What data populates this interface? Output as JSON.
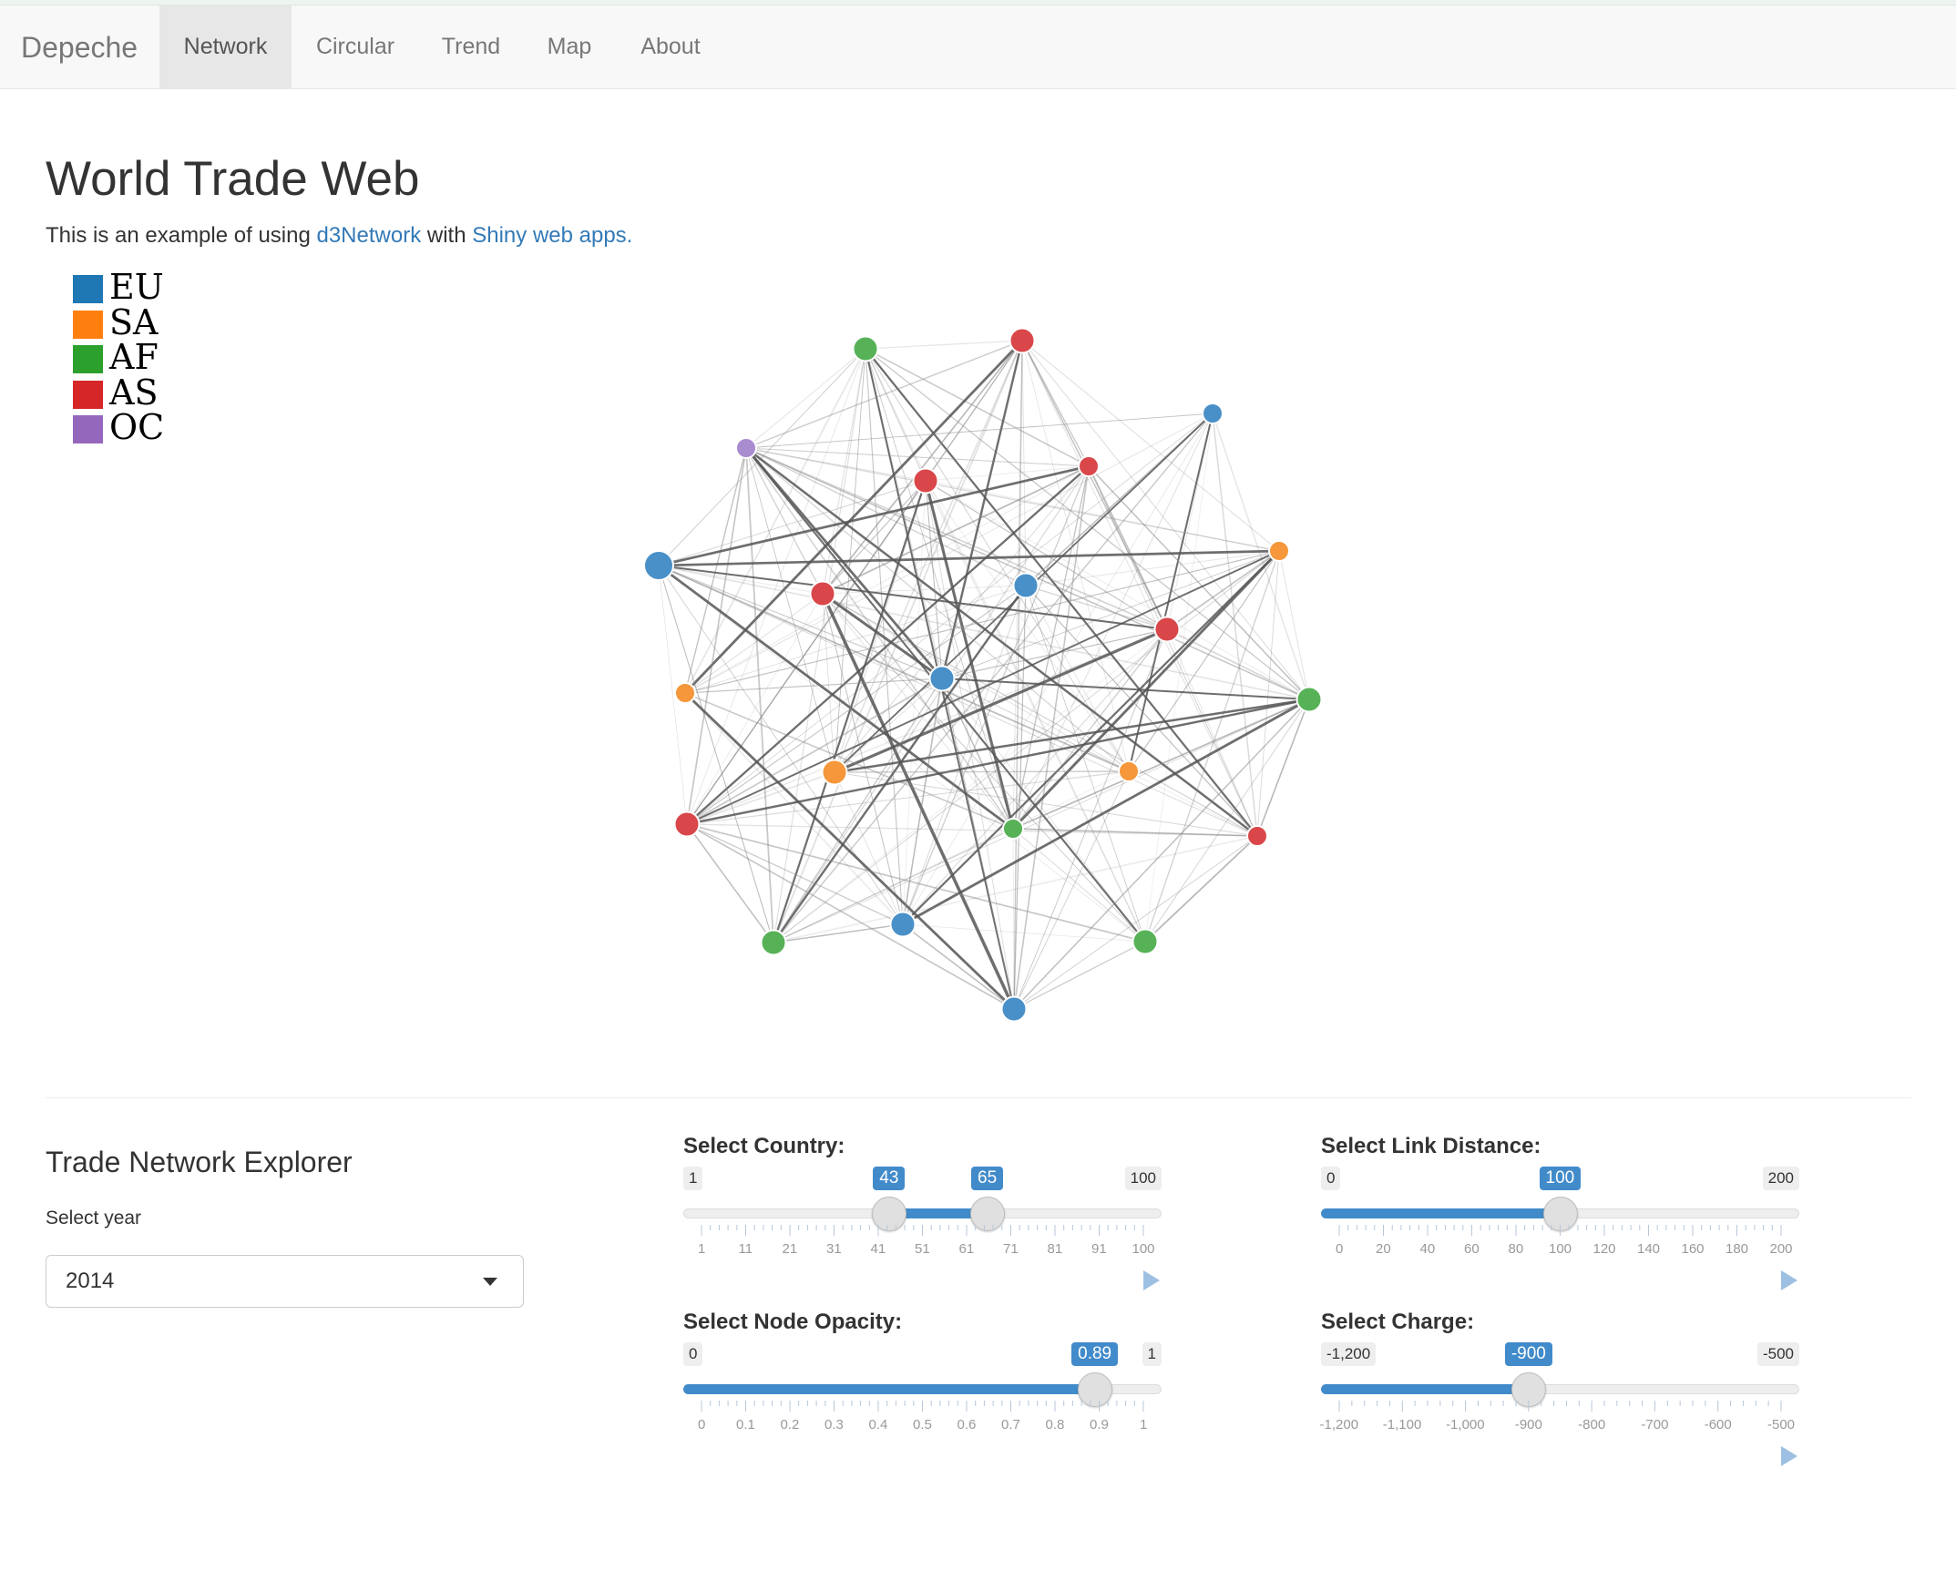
{
  "navbar": {
    "brand": "Depeche",
    "tabs": [
      {
        "label": "Network",
        "active": true
      },
      {
        "label": "Circular",
        "active": false
      },
      {
        "label": "Trend",
        "active": false
      },
      {
        "label": "Map",
        "active": false
      },
      {
        "label": "About",
        "active": false
      }
    ]
  },
  "page": {
    "title": "World Trade Web",
    "intro_text": "This is an example of using",
    "link1": "d3Network",
    "intro_mid": "with",
    "link2": "Shiny web apps."
  },
  "legend": [
    {
      "label": "EU",
      "color": "#1f77b4"
    },
    {
      "label": "SA",
      "color": "#ff7f0e"
    },
    {
      "label": "AF",
      "color": "#2ca02c"
    },
    {
      "label": "AS",
      "color": "#d62728"
    },
    {
      "label": "OC",
      "color": "#9467bd"
    }
  ],
  "network": {
    "node_colors": {
      "EU": "#4a90c8",
      "SA": "#f5973a",
      "AF": "#57b257",
      "AS": "#d9474a",
      "OC": "#a98bd0"
    },
    "node_groups": [
      "AF",
      "AS",
      "EU",
      "OC",
      "AS",
      "AS",
      "SA",
      "EU",
      "EU",
      "AS",
      "AS",
      "SA",
      "EU",
      "AF",
      "SA",
      "SA",
      "AF",
      "AS",
      "AS",
      "AF",
      "EU",
      "AF",
      "EU"
    ],
    "node_size_levels": [
      2,
      2,
      1,
      1,
      2,
      1,
      1,
      3,
      2,
      2,
      2,
      1,
      2,
      2,
      2,
      1,
      1,
      2,
      1,
      2,
      2,
      2,
      2
    ]
  },
  "controls": {
    "panel_title": "Trade Network Explorer",
    "year_label": "Select year",
    "year_value": "2014"
  },
  "sliders": {
    "country": {
      "label": "Select Country:",
      "min": "1",
      "max": "100",
      "low": "43",
      "high": "65",
      "low_value": 43,
      "high_value": 65,
      "range": [
        1,
        100
      ],
      "ticks": [
        "1",
        "11",
        "21",
        "31",
        "41",
        "51",
        "61",
        "71",
        "81",
        "91",
        "100"
      ]
    },
    "distance": {
      "label": "Select Link Distance:",
      "min": "0",
      "max": "200",
      "value": "100",
      "value_num": 100,
      "range": [
        0,
        200
      ],
      "ticks": [
        "0",
        "20",
        "40",
        "60",
        "80",
        "100",
        "120",
        "140",
        "160",
        "180",
        "200"
      ]
    },
    "opacity": {
      "label": "Select Node Opacity:",
      "min": "0",
      "max": "1",
      "value": "0.89",
      "value_num": 0.89,
      "range": [
        0,
        1
      ],
      "ticks": [
        "0",
        "0.1",
        "0.2",
        "0.3",
        "0.4",
        "0.5",
        "0.6",
        "0.7",
        "0.8",
        "0.9",
        "1"
      ]
    },
    "charge": {
      "label": "Select Charge:",
      "min": "-1,200",
      "max": "-500",
      "value": "-900",
      "value_num": -900,
      "range": [
        -1200,
        -500
      ],
      "ticks": [
        "-1,200",
        "-1,100",
        "-1,000",
        "-900",
        "-800",
        "-700",
        "-600",
        "-500"
      ]
    }
  }
}
